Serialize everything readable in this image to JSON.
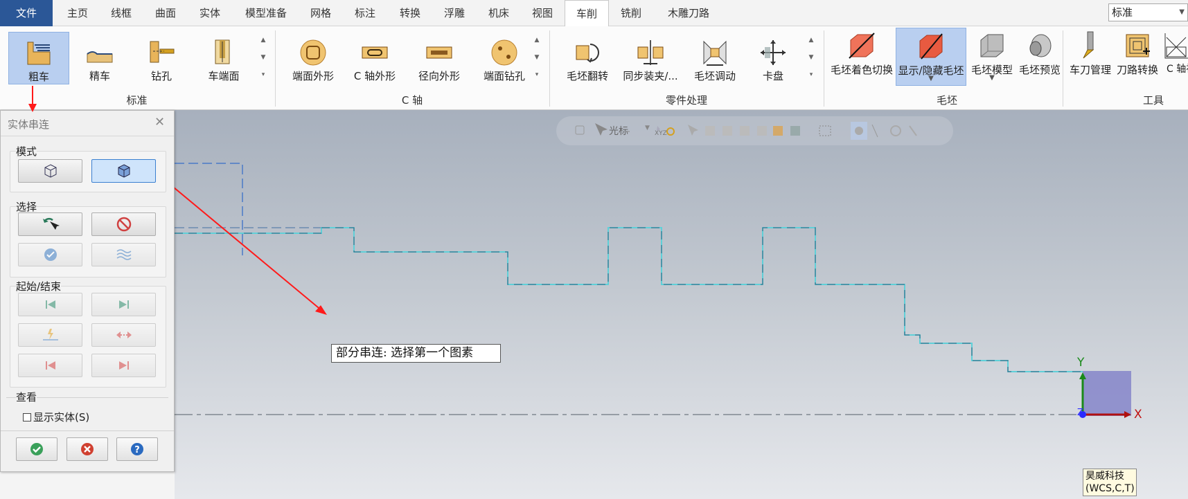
{
  "tabs": [
    "文件",
    "主页",
    "线框",
    "曲面",
    "实体",
    "模型准备",
    "网格",
    "标注",
    "转换",
    "浮雕",
    "机床",
    "视图",
    "车削",
    "铣削",
    "木雕刀路"
  ],
  "view_combo": "标准",
  "ribbon": {
    "groups": [
      {
        "label": "标准",
        "buttons": [
          "粗车",
          "精车",
          "钻孔",
          "车端面"
        ]
      },
      {
        "label": "C 轴",
        "buttons": [
          "端面外形",
          "C 轴外形",
          "径向外形",
          "端面钻孔"
        ]
      },
      {
        "label": "零件处理",
        "buttons": [
          "毛坯翻转",
          "同步装夹/...",
          "毛坯调动",
          "卡盘"
        ]
      },
      {
        "label": "毛坯",
        "buttons": [
          "毛坯着色切换",
          "显示/隐藏毛坯",
          "毛坯模型",
          "毛坯预览"
        ]
      },
      {
        "label": "工具",
        "buttons": [
          "车刀管理",
          "刀路转换",
          "C 轴视图"
        ]
      }
    ]
  },
  "floating_toolbar": {
    "cursor_label": "光标",
    "xyz_label": "XYZ"
  },
  "panel": {
    "title": "实体串连",
    "mode_label": "模式",
    "select_label": "选择",
    "startend_label": "起始/结束",
    "view_label": "查看",
    "show_solid": "显示实体(S)"
  },
  "tooltip": "部分串连: 选择第一个图素",
  "axis": {
    "x": "X",
    "y": "Y",
    "z": "Z"
  },
  "brand": {
    "line1": "昊威科技",
    "line2": "(WCS,C,T)"
  },
  "colors": {
    "accent": "#2b5797",
    "profile": "#5fd0d8",
    "arrow": "#ff1a1a",
    "selected": "#b9cff0"
  }
}
